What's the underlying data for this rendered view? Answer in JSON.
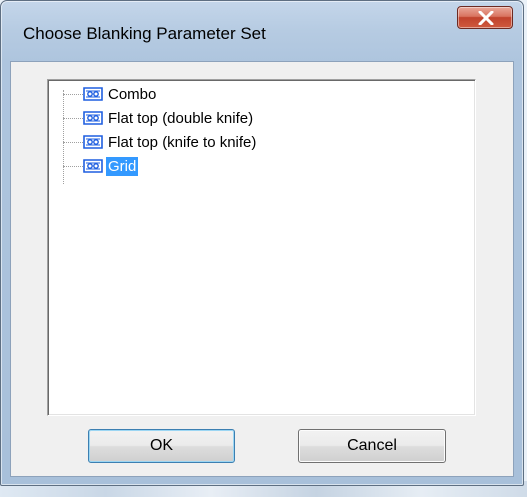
{
  "window": {
    "title": "Choose Blanking Parameter Set"
  },
  "tree": {
    "items": [
      {
        "label": "Combo",
        "selected": false
      },
      {
        "label": "Flat top (double knife)",
        "selected": false
      },
      {
        "label": "Flat top (knife to knife)",
        "selected": false
      },
      {
        "label": "Grid",
        "selected": true
      }
    ],
    "icon": "parameter-set-icon"
  },
  "buttons": {
    "ok_label": "OK",
    "cancel_label": "Cancel"
  },
  "colors": {
    "selection": "#3399ff",
    "icon": "#1f5fe0",
    "close": "#c0422c"
  }
}
